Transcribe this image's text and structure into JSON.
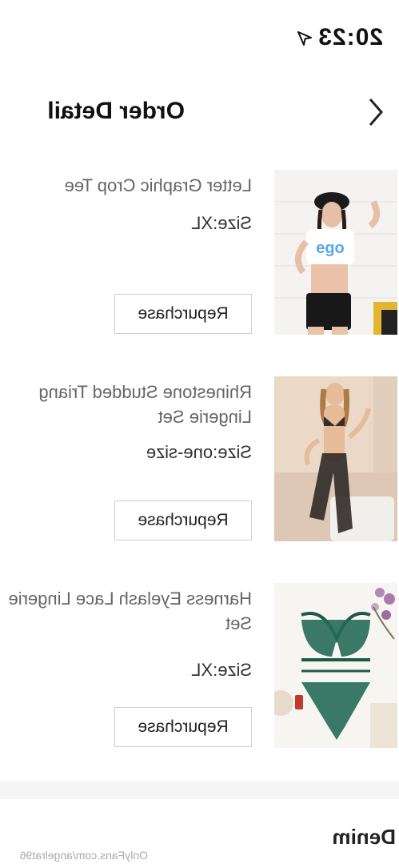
{
  "status_bar": {
    "time": "20:23"
  },
  "header": {
    "title": "Order Detail"
  },
  "orders": [
    {
      "name": "Letter Graphic Crop Tee",
      "size": "Size:XL",
      "button": "Repurchase"
    },
    {
      "name": "Rhinestone Studded Triang Lingerie Set",
      "size": "Size:one-size",
      "button": "Repurchase"
    },
    {
      "name": "Harness Eyelash Lace Lingerie Set",
      "size": "Size:XL",
      "button": "Repurchase"
    }
  ],
  "section": {
    "title": "Denim"
  },
  "watermark": "OnlyFans.com/angelrat96",
  "colors": {
    "background": "#ffffff",
    "text": "#222222",
    "muted": "#666666",
    "divider": "#f5f5f5"
  },
  "icons": {
    "back": "chevron-left-icon",
    "location": "location-arrow-icon"
  }
}
